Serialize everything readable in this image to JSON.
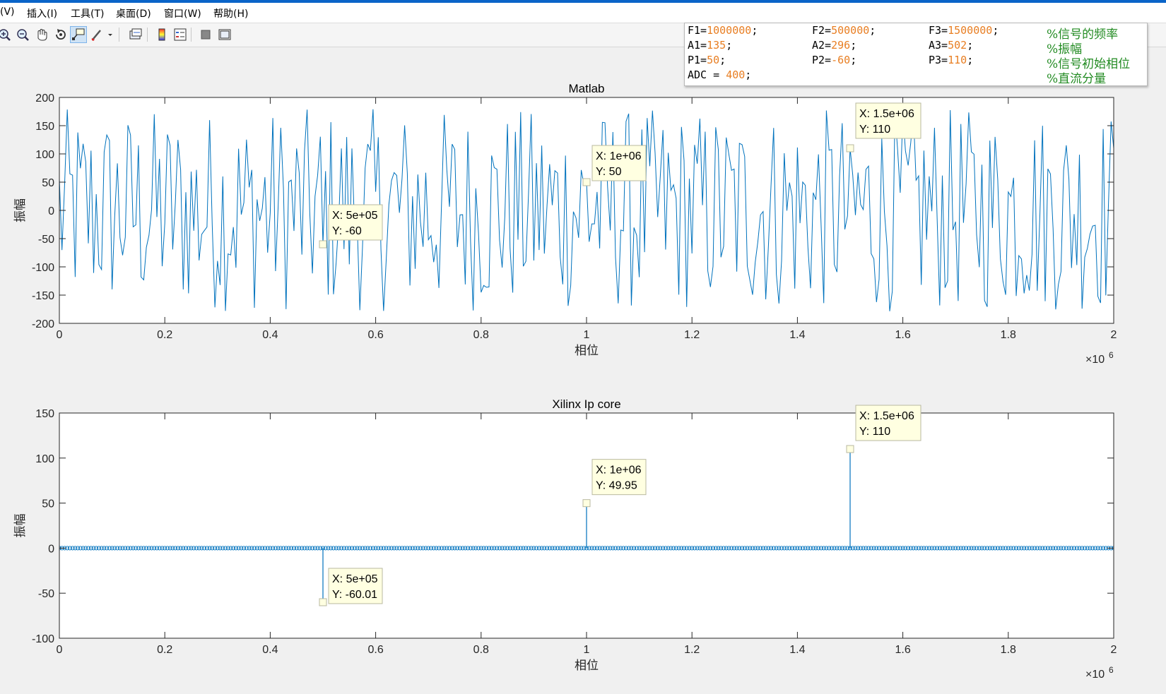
{
  "menubar": {
    "items": [
      {
        "label": "(V)",
        "x": 0
      },
      {
        "label": "插入(I)",
        "x": 38
      },
      {
        "label": "工具(T)",
        "x": 100
      },
      {
        "label": "桌面(D)",
        "x": 164
      },
      {
        "label": "窗口(W)",
        "x": 232
      },
      {
        "label": "帮助(H)",
        "x": 302
      }
    ]
  },
  "toolbar": {
    "icons": [
      "zoom-in-icon",
      "zoom-out-icon",
      "pan-hand-icon",
      "rotate-3d-icon",
      "data-cursor-icon",
      "brush-icon",
      "link-plot-icon",
      "insert-colorbar-icon",
      "insert-legend-icon",
      "hide-plot-tools-icon",
      "show-plot-tools-icon"
    ]
  },
  "code_popup": {
    "lines": [
      [
        {
          "k": "F1=",
          "v": "1000000",
          "e": ";"
        },
        {
          "k": "F2=",
          "v": "500000",
          "e": ";"
        },
        {
          "k": "F3=",
          "v": "1500000",
          "e": ";"
        },
        {
          "c": "%信号的频率"
        }
      ],
      [
        {
          "k": "A1=",
          "v": "135",
          "e": ";"
        },
        {
          "k": "A2=",
          "v": "296",
          "e": ";"
        },
        {
          "k": "A3=",
          "v": "502",
          "e": ";"
        },
        {
          "c": "%振幅"
        }
      ],
      [
        {
          "k": "P1=",
          "v": "50",
          "e": ";"
        },
        {
          "k": "P2=",
          "v": "-60",
          "e": ";"
        },
        {
          "k": "P3=",
          "v": "110",
          "e": ";"
        },
        {
          "c": "%信号初始相位"
        }
      ],
      [
        {
          "k": "ADC = ",
          "v": "400",
          "e": ";"
        },
        null,
        null,
        {
          "c": "%直流分量"
        }
      ]
    ]
  },
  "chart_data": [
    {
      "type": "line",
      "title": "Matlab",
      "xlabel": "相位",
      "ylabel": "振幅",
      "xlim": [
        0,
        2000000
      ],
      "ylim": [
        -200,
        200
      ],
      "x_exponent_label": "×10",
      "x_exponent": "6",
      "xticks": [
        "0",
        "0.2",
        "0.4",
        "0.6",
        "0.8",
        "1",
        "1.2",
        "1.4",
        "1.6",
        "1.8",
        "2"
      ],
      "yticks": [
        "200",
        "150",
        "100",
        "50",
        "0",
        "-50",
        "-100",
        "-150",
        "-200"
      ],
      "series_color": "#0072bd",
      "series": [
        {
          "name": "",
          "points": 400,
          "x_range": [
            0,
            2000000
          ],
          "amplitude_range": [
            -180,
            180
          ]
        }
      ],
      "datatips": [
        {
          "x": 500000,
          "y": -60,
          "label_x": "X: 5e+05",
          "label_y": "Y: -60"
        },
        {
          "x": 1000000,
          "y": 50,
          "label_x": "X: 1e+06",
          "label_y": "Y: 50"
        },
        {
          "x": 1500000,
          "y": 110,
          "label_x": "X: 1.5e+06",
          "label_y": "Y: 110"
        }
      ]
    },
    {
      "type": "stem",
      "title": "Xilinx Ip core",
      "xlabel": "相位",
      "ylabel": "振幅",
      "xlim": [
        0,
        2000000
      ],
      "ylim": [
        -100,
        150
      ],
      "x_exponent_label": "×10",
      "x_exponent": "6",
      "xticks": [
        "0",
        "0.2",
        "0.4",
        "0.6",
        "0.8",
        "1",
        "1.2",
        "1.4",
        "1.6",
        "1.8",
        "2"
      ],
      "yticks": [
        "150",
        "100",
        "50",
        "0",
        "-50",
        "-100"
      ],
      "series_color": "#0072bd",
      "stems": [
        {
          "x": 500000,
          "y": -60.01
        },
        {
          "x": 1000000,
          "y": 49.95
        },
        {
          "x": 1500000,
          "y": 110
        }
      ],
      "datatips": [
        {
          "x": 500000,
          "y": -60.01,
          "label_x": "X: 5e+05",
          "label_y": "Y: -60.01"
        },
        {
          "x": 1000000,
          "y": 49.95,
          "label_x": "X: 1e+06",
          "label_y": "Y: 49.95"
        },
        {
          "x": 1500000,
          "y": 110,
          "label_x": "X: 1.5e+06",
          "label_y": "Y: 110"
        }
      ]
    }
  ]
}
